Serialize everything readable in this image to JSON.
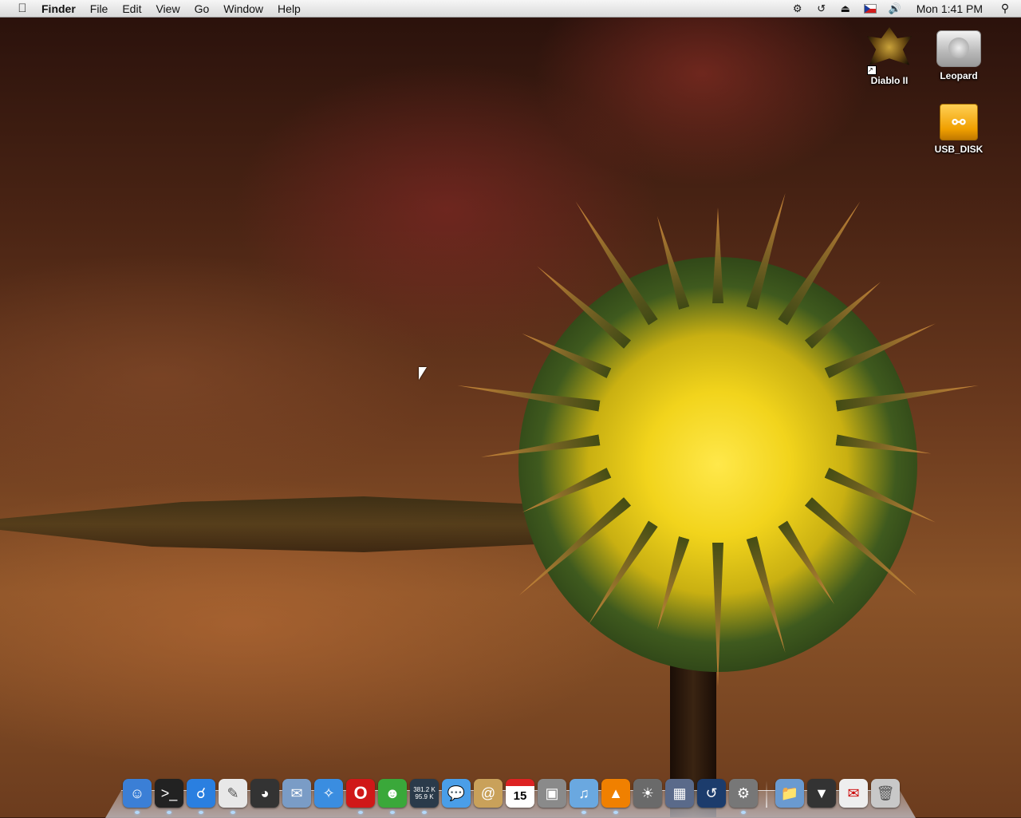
{
  "menubar": {
    "apple_icon": "apple-icon",
    "app_name": "Finder",
    "menus": [
      "File",
      "Edit",
      "View",
      "Go",
      "Window",
      "Help"
    ],
    "status_icons": [
      "robot-icon",
      "time-machine-icon",
      "eject-icon",
      "czech-flag-icon",
      "volume-icon"
    ],
    "clock": "Mon 1:41 PM",
    "spotlight_icon": "magnifier-icon"
  },
  "desktop": {
    "icons": [
      {
        "label": "Diablo II",
        "icon": "diablo-alias-icon"
      },
      {
        "label": "Leopard",
        "icon": "hard-drive-icon"
      },
      {
        "label": "USB_DISK",
        "icon": "usb-drive-icon"
      }
    ]
  },
  "dock": {
    "apps": [
      {
        "name": "finder",
        "color": "#3b7fd6"
      },
      {
        "name": "terminal",
        "color": "#222222"
      },
      {
        "name": "migration",
        "color": "#2a7fe0"
      },
      {
        "name": "textedit",
        "color": "#e8e8e8"
      },
      {
        "name": "speedometer",
        "color": "#333333"
      },
      {
        "name": "mail-stamp",
        "color": "#7a9cc6"
      },
      {
        "name": "safari",
        "color": "#3a8de0"
      },
      {
        "name": "opera",
        "color": "#d01818"
      },
      {
        "name": "adium",
        "color": "#3aa83a"
      },
      {
        "name": "network-monitor",
        "color": "#2a3a4a"
      },
      {
        "name": "ichat",
        "color": "#4a9ee8"
      },
      {
        "name": "address-book",
        "color": "#c9a15a"
      },
      {
        "name": "ical",
        "color": "#ffffff"
      },
      {
        "name": "preview",
        "color": "#8a8a8a"
      },
      {
        "name": "itunes",
        "color": "#6aa8e0"
      },
      {
        "name": "vlc",
        "color": "#f08000"
      },
      {
        "name": "iphoto",
        "color": "#6a6a6a"
      },
      {
        "name": "spaces",
        "color": "#5a6a8a"
      },
      {
        "name": "time-machine",
        "color": "#1c3c6c"
      },
      {
        "name": "system-preferences",
        "color": "#777777"
      }
    ],
    "net_up": "381.2 K",
    "net_down": "95.9 K",
    "calendar_day": "15",
    "others": [
      {
        "name": "documents-folder",
        "color": "#6a9ad0"
      },
      {
        "name": "downloads",
        "color": "#333333"
      },
      {
        "name": "mail-badge",
        "color": "#eeeeee"
      },
      {
        "name": "trash",
        "color": "#c8c8c8"
      }
    ]
  }
}
